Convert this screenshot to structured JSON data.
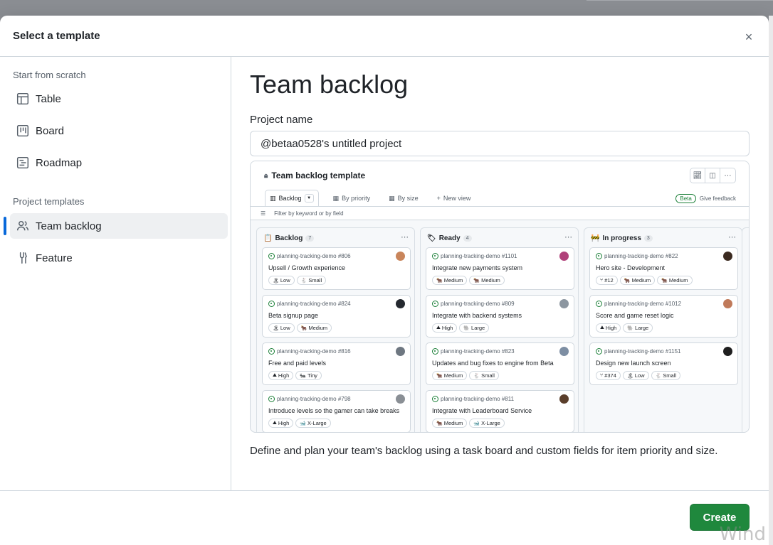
{
  "dialog": {
    "title": "Select a template",
    "close_label": "×"
  },
  "sidebar": {
    "scratch_heading": "Start from scratch",
    "scratch_items": [
      {
        "label": "Table",
        "icon": "table-icon"
      },
      {
        "label": "Board",
        "icon": "board-icon"
      },
      {
        "label": "Roadmap",
        "icon": "roadmap-icon"
      }
    ],
    "templates_heading": "Project templates",
    "template_items": [
      {
        "label": "Team backlog",
        "icon": "people-icon",
        "selected": true
      },
      {
        "label": "Feature",
        "icon": "tools-icon",
        "selected": false
      }
    ]
  },
  "main": {
    "title": "Team backlog",
    "project_name_label": "Project name",
    "project_name_value": "@betaa0528's untitled project",
    "description": "Define and plan your team's backlog using a task board and custom fields for item priority and size."
  },
  "preview": {
    "title": "Team backlog template",
    "tabs": [
      "Backlog",
      "By priority",
      "By size",
      "New view"
    ],
    "beta_badge": "Beta",
    "feedback_label": "Give feedback",
    "filter_placeholder": "Filter by keyword or by field",
    "columns": [
      {
        "name": "Backlog",
        "count": "7",
        "emoji": "📋",
        "cards": [
          {
            "ref": "planning-tracking-demo #806",
            "title": "Upsell / Growth experience",
            "tags": [
              "Low",
              "Small"
            ],
            "avatar_color": "#c9855b"
          },
          {
            "ref": "planning-tracking-demo #824",
            "title": "Beta signup page",
            "tags": [
              "Low",
              "Medium"
            ],
            "avatar_color": "#24292f"
          },
          {
            "ref": "planning-tracking-demo #816",
            "title": "Free and paid levels",
            "tags": [
              "High",
              "Tiny"
            ],
            "avatar_color": "#6e7781"
          },
          {
            "ref": "planning-tracking-demo #798",
            "title": "Introduce levels so the gamer can take breaks",
            "tags": [
              "High",
              "X-Large"
            ],
            "avatar_color": "#8a8f95"
          }
        ]
      },
      {
        "name": "Ready",
        "count": "4",
        "emoji": "🏷",
        "cards": [
          {
            "ref": "planning-tracking-demo #1101",
            "title": "Integrate new payments system",
            "tags": [
              "Medium",
              "Medium"
            ],
            "avatar_color": "#b0417a"
          },
          {
            "ref": "planning-tracking-demo #809",
            "title": "Integrate with backend systems",
            "tags": [
              "High",
              "Large"
            ],
            "avatar_color": "#8c96a0"
          },
          {
            "ref": "planning-tracking-demo #823",
            "title": "Updates and bug fixes to engine from Beta",
            "tags": [
              "Medium",
              "Small"
            ],
            "avatar_color": "#7d8ea3"
          },
          {
            "ref": "planning-tracking-demo #811",
            "title": "Integrate with Leaderboard Service",
            "tags": [
              "Medium",
              "X-Large"
            ],
            "avatar_color": "#5a3e2b"
          }
        ]
      },
      {
        "name": "In progress",
        "count": "3",
        "emoji": "🚧",
        "cards": [
          {
            "ref": "planning-tracking-demo #822",
            "title": "Hero site - Development",
            "tags": [
              "#12",
              "Medium",
              "Medium"
            ],
            "avatar_color": "#3b2a20"
          },
          {
            "ref": "planning-tracking-demo #1012",
            "title": "Score and game reset logic",
            "tags": [
              "High",
              "Large"
            ],
            "avatar_color": "#c07a5a"
          },
          {
            "ref": "planning-tracking-demo #1151",
            "title": "Design new launch screen",
            "tags": [
              "#374",
              "Low",
              "Small"
            ],
            "avatar_color": "#1f1f1f"
          }
        ]
      }
    ]
  },
  "footer": {
    "create_label": "Create",
    "watermark": "Wind"
  },
  "colors": {
    "primary_button": "#1f883d",
    "accent": "#0969da",
    "selected_bg": "#eef0f2"
  }
}
